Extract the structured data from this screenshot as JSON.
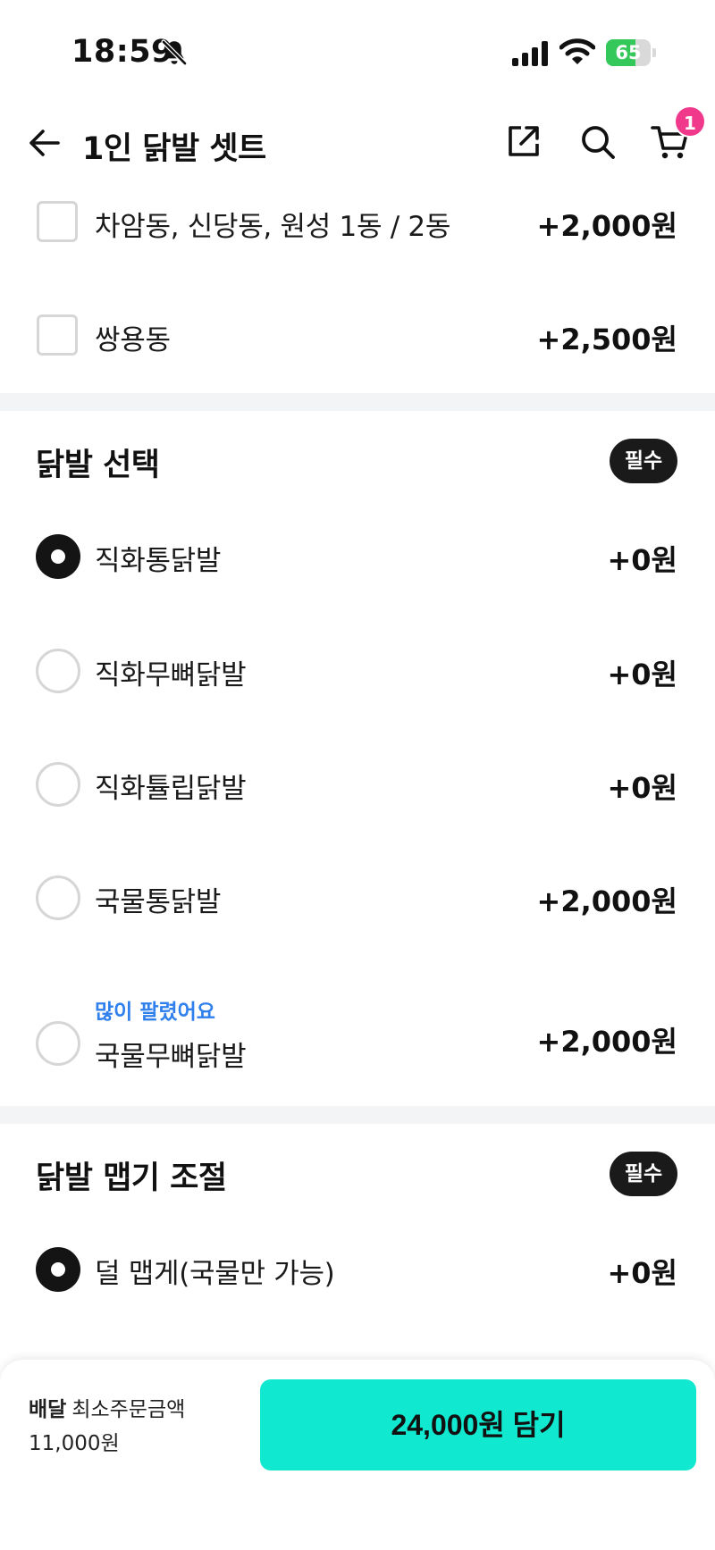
{
  "status_bar": {
    "time": "18:59",
    "battery_percent": 65,
    "battery_label": "65",
    "icons": [
      "bell-slash-icon",
      "signal-icon",
      "wifi-icon",
      "battery-charging-icon"
    ]
  },
  "header": {
    "title": "1인 닭발 셋트",
    "cart_count": "1",
    "icons": [
      "back-arrow-icon",
      "share-icon",
      "search-icon",
      "cart-icon"
    ]
  },
  "delivery_area_options": [
    {
      "label": "차암동, 신당동, 원성 1동 / 2동",
      "price": "+2,000원",
      "checked": false
    },
    {
      "label": "쌍용동",
      "price": "+2,500원",
      "checked": false
    }
  ],
  "sections": {
    "feet_select": {
      "title": "닭발 선택",
      "badge": "필수",
      "options": [
        {
          "label": "직화통닭발",
          "price": "+0원",
          "selected": true
        },
        {
          "label": "직화무뼈닭발",
          "price": "+0원",
          "selected": false
        },
        {
          "label": "직화튤립닭발",
          "price": "+0원",
          "selected": false
        },
        {
          "label": "국물통닭발",
          "price": "+2,000원",
          "selected": false
        },
        {
          "label": "국물무뼈닭발",
          "price": "+2,000원",
          "selected": false,
          "tag": "많이 팔렸어요"
        }
      ]
    },
    "spice_level": {
      "title": "닭발 맵기 조절",
      "badge": "필수",
      "options": [
        {
          "label": "덜 맵게(국물만 가능)",
          "price": "+0원",
          "selected": true
        }
      ]
    }
  },
  "bottom_bar": {
    "delivery_label": "배달",
    "min_order_label": "최소주문금액",
    "min_order_amount": "11,000원",
    "add_button_label": "24,000원 담기"
  },
  "colors": {
    "accent": "#10e8cf",
    "badge_pink": "#f0398b",
    "popular_blue": "#2f80ed",
    "battery_green": "#34c759"
  }
}
